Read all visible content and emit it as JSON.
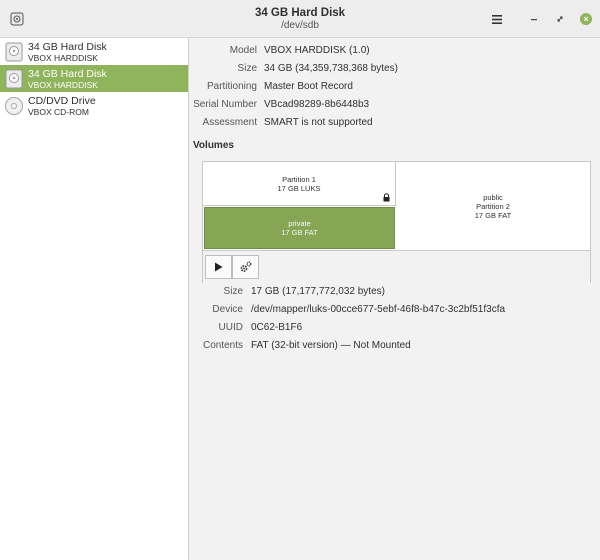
{
  "titlebar": {
    "title": "34 GB Hard Disk",
    "subtitle": "/dev/sdb",
    "icons": {
      "app": "disk-app-icon",
      "menu": "hamburger-menu-icon",
      "minimize": "minimize-icon",
      "maximize": "maximize-icon",
      "close": "close-icon"
    },
    "close_glyph": "×"
  },
  "sidebar": {
    "items": [
      {
        "name": "34 GB Hard Disk",
        "model": "VBOX HARDDISK",
        "icon": "hard-disk-icon",
        "selected": false
      },
      {
        "name": "34 GB Hard Disk",
        "model": "VBOX HARDDISK",
        "icon": "hard-disk-icon",
        "selected": true
      },
      {
        "name": "CD/DVD Drive",
        "model": "VBOX CD-ROM",
        "icon": "optical-drive-icon",
        "selected": false
      }
    ]
  },
  "disk": {
    "model_label": "Model",
    "model": "VBOX HARDDISK (1.0)",
    "size_label": "Size",
    "size": "34 GB (34,359,738,368 bytes)",
    "partitioning_label": "Partitioning",
    "partitioning": "Master Boot Record",
    "serial_label": "Serial Number",
    "serial": "VBcad98289-8b6448b3",
    "assessment_label": "Assessment",
    "assessment": "SMART is not supported"
  },
  "volumes": {
    "heading": "Volumes",
    "partition1": {
      "name": "Partition 1",
      "desc": "17 GB LUKS"
    },
    "private": {
      "name": "private",
      "desc": "17 GB FAT"
    },
    "public": {
      "name": "public",
      "sub": "Partition 2",
      "desc": "17 GB FAT"
    },
    "toolbar": {
      "play_icon": "play-icon",
      "settings_icon": "gears-icon"
    }
  },
  "selected_volume": {
    "size_label": "Size",
    "size": "17 GB (17,177,772,032 bytes)",
    "device_label": "Device",
    "device": "/dev/mapper/luks-00cce677-5ebf-46f8-b47c-3c2bf51f3cfa",
    "uuid_label": "UUID",
    "uuid": "0C62-B1F6",
    "contents_label": "Contents",
    "contents": "FAT (32-bit version) — Not Mounted"
  },
  "colors": {
    "accent": "#8fb45c",
    "private_fill": "#86a656"
  }
}
